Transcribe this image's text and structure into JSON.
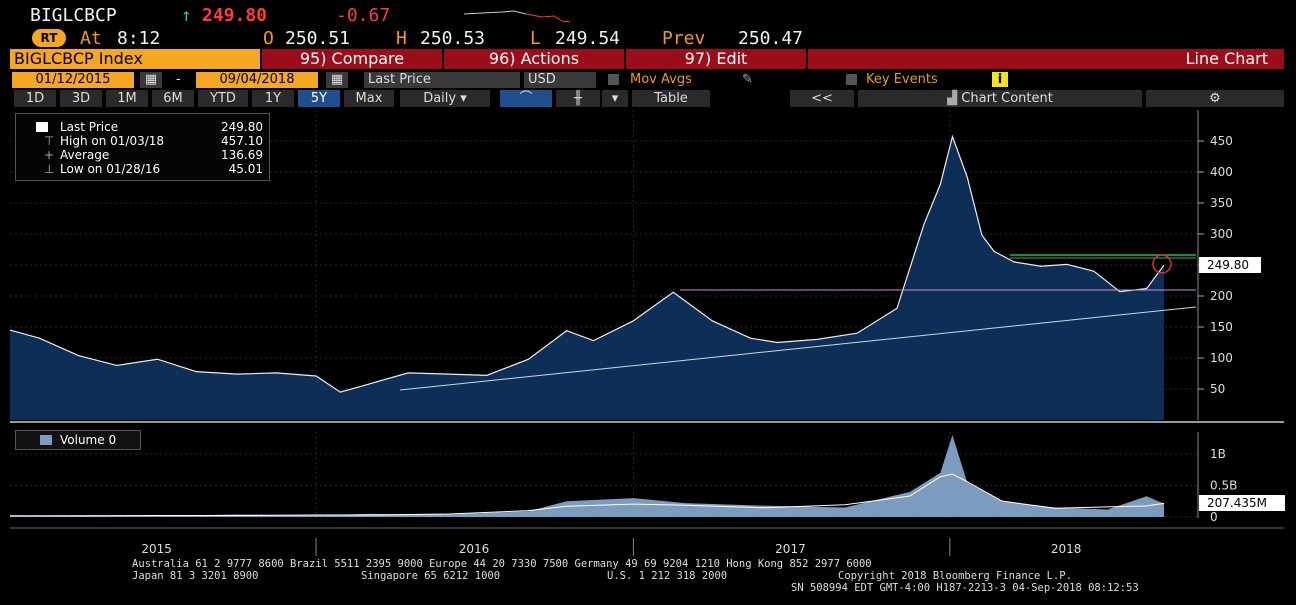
{
  "header": {
    "ticker": "BIGLCBCP",
    "arrow": "↑",
    "last": "249.80",
    "change": "-0.67",
    "rt_badge": "RT",
    "at_label": "At",
    "time": "8:12",
    "open_label": "O",
    "open": "250.51",
    "high_label": "H",
    "high": "250.53",
    "low_label": "L",
    "low": "249.54",
    "prev_label": "Prev",
    "prev": "250.47"
  },
  "toolbar": {
    "security": "BIGLCBCP Index",
    "compare": "95) Compare",
    "actions": "96) Actions",
    "edit": "97) Edit",
    "chart_type": "Line Chart"
  },
  "controls": {
    "start_date": "01/12/2015",
    "dash": "-",
    "end_date": "09/04/2018",
    "field": "Last Price",
    "currency": "USD",
    "mov_avgs": "Mov Avgs",
    "key_events": "Key Events",
    "info_badge": "i"
  },
  "tabs": [
    "1D",
    "3D",
    "1M",
    "6M",
    "YTD",
    "1Y",
    "5Y",
    "Max"
  ],
  "active_tab": "5Y",
  "frequency": "Daily",
  "table_label": "Table",
  "collapse_label": "<<",
  "chart_content_label": "Chart Content",
  "legend": {
    "rows": [
      {
        "label": "Last Price",
        "value": "249.80"
      },
      {
        "label": "High on 01/03/18",
        "value": "457.10"
      },
      {
        "label": "Average",
        "value": "136.69"
      },
      {
        "label": "Low on 01/28/16",
        "value": "45.01"
      }
    ]
  },
  "volume_legend": "Volume 0",
  "colors": {
    "price_fill": "#0d2f57",
    "price_line": "#e8eef5",
    "volume_fill": "#7d9bbf",
    "header_red": "#9b0d1a",
    "accent_orange": "#f5a623",
    "resistance_green": "#2db34a",
    "support_pink": "#c98bd8"
  },
  "chart_data": [
    {
      "type": "area",
      "title": "BIGLCBCP Index",
      "series": [
        {
          "name": "Last Price",
          "x": [
            "2015-01-12",
            "2015-02-15",
            "2015-04-01",
            "2015-05-15",
            "2015-07-01",
            "2015-08-15",
            "2015-10-01",
            "2015-11-15",
            "2015-12-31",
            "2016-01-28",
            "2016-03-01",
            "2016-04-15",
            "2016-06-01",
            "2016-07-15",
            "2016-09-01",
            "2016-10-15",
            "2016-11-15",
            "2016-12-31",
            "2017-02-15",
            "2017-04-01",
            "2017-05-15",
            "2017-06-15",
            "2017-07-31",
            "2017-09-15",
            "2017-10-31",
            "2017-12-01",
            "2017-12-20",
            "2018-01-03",
            "2018-01-20",
            "2018-02-06",
            "2018-02-20",
            "2018-03-15",
            "2018-04-15",
            "2018-05-15",
            "2018-06-15",
            "2018-07-15",
            "2018-08-15",
            "2018-09-04"
          ],
          "values": [
            145,
            132,
            104,
            88,
            98,
            78,
            74,
            76,
            71,
            45,
            58,
            76,
            74,
            72,
            98,
            144,
            128,
            160,
            206,
            160,
            132,
            125,
            130,
            140,
            180,
            315,
            380,
            457,
            392,
            298,
            272,
            255,
            248,
            251,
            240,
            207,
            212,
            249.8
          ]
        }
      ],
      "y_ticks": [
        50,
        100,
        150,
        200,
        250,
        300,
        350,
        400,
        450
      ],
      "ylim": [
        0,
        500
      ],
      "last_label": "249.80",
      "x_labels": [
        "2015",
        "2016",
        "2017",
        "2018"
      ],
      "grid": true
    },
    {
      "type": "area",
      "series": [
        {
          "name": "Volume",
          "x": [
            "2015-01-12",
            "2015-04-01",
            "2015-07-01",
            "2015-10-01",
            "2015-12-31",
            "2016-03-01",
            "2016-06-01",
            "2016-09-01",
            "2016-10-15",
            "2016-12-31",
            "2017-03-01",
            "2017-06-01",
            "2017-09-01",
            "2017-11-15",
            "2017-12-20",
            "2018-01-03",
            "2018-01-20",
            "2018-03-01",
            "2018-05-01",
            "2018-07-01",
            "2018-08-15",
            "2018-09-04"
          ],
          "values": [
            0.02,
            0.03,
            0.02,
            0.04,
            0.03,
            0.05,
            0.04,
            0.09,
            0.25,
            0.3,
            0.22,
            0.18,
            0.15,
            0.4,
            0.7,
            1.3,
            0.55,
            0.25,
            0.15,
            0.12,
            0.33,
            0.21
          ]
        }
      ],
      "y_ticks_labels": [
        "1B",
        "0.5B",
        "0"
      ],
      "y_ticks": [
        1,
        0.5,
        0
      ],
      "ylim": [
        0,
        1.35
      ],
      "last_label": "207.435M"
    }
  ],
  "footer": {
    "line1": "Australia 61 2 9777 8600 Brazil 5511 2395 9000 Europe 44 20 7330 7500 Germany 49 69 9204 1210 Hong Kong 852 2977 6000",
    "line2a": "Japan 81 3 3201 8900",
    "line2b": "Singapore 65 6212 1000",
    "line2c": "U.S. 1 212 318 2000",
    "line2d": "Copyright 2018 Bloomberg Finance L.P.",
    "line3": "SN 508994 EDT  GMT-4:00 H187-2213-3 04-Sep-2018 08:12:53"
  }
}
